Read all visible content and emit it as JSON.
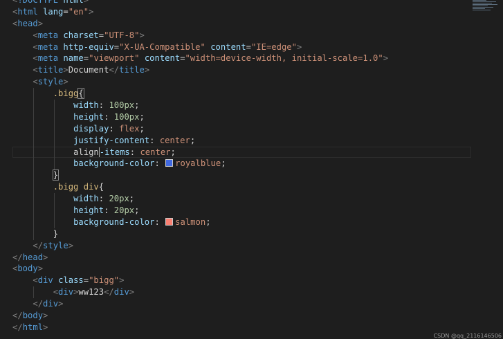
{
  "editor": {
    "language": "html",
    "colors": {
      "background": "#1e1e1e",
      "tag": "#569cd6",
      "attribute": "#9cdcfe",
      "string": "#ce9178",
      "selector": "#d7ba7d",
      "number": "#b5cea8"
    },
    "lines": [
      "<!DOCTYPE html>",
      "<html lang=\"en\">",
      "<head>",
      "    <meta charset=\"UTF-8\">",
      "    <meta http-equiv=\"X-UA-Compatible\" content=\"IE=edge\">",
      "    <meta name=\"viewport\" content=\"width=device-width, initial-scale=1.0\">",
      "    <title>Document</title>",
      "    <style>",
      "        .bigg{",
      "            width: 100px;",
      "            height: 100px;",
      "            display: flex;",
      "            justify-content: center;",
      "            align-items: center;",
      "            background-color: royalblue;",
      "        }",
      "        .bigg div{",
      "            width: 20px;",
      "            height: 20px;",
      "            background-color: salmon;",
      "        }",
      "    </style>",
      "</head>",
      "<body>",
      "    <div class=\"bigg\">",
      "        <div>ww123</div>",
      "    </div>",
      "</body>",
      "</html>"
    ],
    "color_swatches": [
      {
        "line": 14,
        "value": "royalblue",
        "hex": "#4169e1"
      },
      {
        "line": 19,
        "value": "salmon",
        "hex": "#fa8072"
      }
    ],
    "cursor_line": 13
  },
  "watermark": "CSDN @qq_2116146506"
}
